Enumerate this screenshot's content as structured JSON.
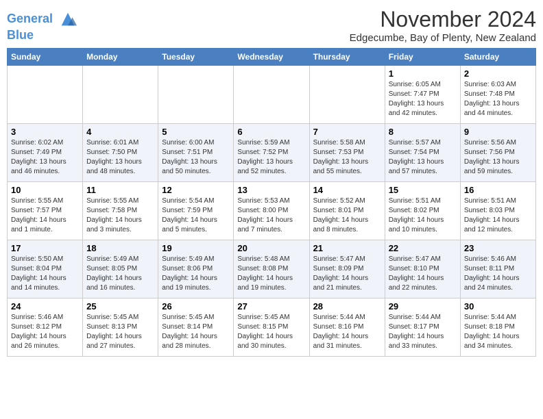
{
  "header": {
    "logo_line1": "General",
    "logo_line2": "Blue",
    "month": "November 2024",
    "location": "Edgecumbe, Bay of Plenty, New Zealand"
  },
  "days_of_week": [
    "Sunday",
    "Monday",
    "Tuesday",
    "Wednesday",
    "Thursday",
    "Friday",
    "Saturday"
  ],
  "weeks": [
    [
      {
        "day": "",
        "info": ""
      },
      {
        "day": "",
        "info": ""
      },
      {
        "day": "",
        "info": ""
      },
      {
        "day": "",
        "info": ""
      },
      {
        "day": "",
        "info": ""
      },
      {
        "day": "1",
        "info": "Sunrise: 6:05 AM\nSunset: 7:47 PM\nDaylight: 13 hours\nand 42 minutes."
      },
      {
        "day": "2",
        "info": "Sunrise: 6:03 AM\nSunset: 7:48 PM\nDaylight: 13 hours\nand 44 minutes."
      }
    ],
    [
      {
        "day": "3",
        "info": "Sunrise: 6:02 AM\nSunset: 7:49 PM\nDaylight: 13 hours\nand 46 minutes."
      },
      {
        "day": "4",
        "info": "Sunrise: 6:01 AM\nSunset: 7:50 PM\nDaylight: 13 hours\nand 48 minutes."
      },
      {
        "day": "5",
        "info": "Sunrise: 6:00 AM\nSunset: 7:51 PM\nDaylight: 13 hours\nand 50 minutes."
      },
      {
        "day": "6",
        "info": "Sunrise: 5:59 AM\nSunset: 7:52 PM\nDaylight: 13 hours\nand 52 minutes."
      },
      {
        "day": "7",
        "info": "Sunrise: 5:58 AM\nSunset: 7:53 PM\nDaylight: 13 hours\nand 55 minutes."
      },
      {
        "day": "8",
        "info": "Sunrise: 5:57 AM\nSunset: 7:54 PM\nDaylight: 13 hours\nand 57 minutes."
      },
      {
        "day": "9",
        "info": "Sunrise: 5:56 AM\nSunset: 7:56 PM\nDaylight: 13 hours\nand 59 minutes."
      }
    ],
    [
      {
        "day": "10",
        "info": "Sunrise: 5:55 AM\nSunset: 7:57 PM\nDaylight: 14 hours\nand 1 minute."
      },
      {
        "day": "11",
        "info": "Sunrise: 5:55 AM\nSunset: 7:58 PM\nDaylight: 14 hours\nand 3 minutes."
      },
      {
        "day": "12",
        "info": "Sunrise: 5:54 AM\nSunset: 7:59 PM\nDaylight: 14 hours\nand 5 minutes."
      },
      {
        "day": "13",
        "info": "Sunrise: 5:53 AM\nSunset: 8:00 PM\nDaylight: 14 hours\nand 7 minutes."
      },
      {
        "day": "14",
        "info": "Sunrise: 5:52 AM\nSunset: 8:01 PM\nDaylight: 14 hours\nand 8 minutes."
      },
      {
        "day": "15",
        "info": "Sunrise: 5:51 AM\nSunset: 8:02 PM\nDaylight: 14 hours\nand 10 minutes."
      },
      {
        "day": "16",
        "info": "Sunrise: 5:51 AM\nSunset: 8:03 PM\nDaylight: 14 hours\nand 12 minutes."
      }
    ],
    [
      {
        "day": "17",
        "info": "Sunrise: 5:50 AM\nSunset: 8:04 PM\nDaylight: 14 hours\nand 14 minutes."
      },
      {
        "day": "18",
        "info": "Sunrise: 5:49 AM\nSunset: 8:05 PM\nDaylight: 14 hours\nand 16 minutes."
      },
      {
        "day": "19",
        "info": "Sunrise: 5:49 AM\nSunset: 8:06 PM\nDaylight: 14 hours\nand 19 minutes."
      },
      {
        "day": "20",
        "info": "Sunrise: 5:48 AM\nSunset: 8:08 PM\nDaylight: 14 hours\nand 19 minutes."
      },
      {
        "day": "21",
        "info": "Sunrise: 5:47 AM\nSunset: 8:09 PM\nDaylight: 14 hours\nand 21 minutes."
      },
      {
        "day": "22",
        "info": "Sunrise: 5:47 AM\nSunset: 8:10 PM\nDaylight: 14 hours\nand 22 minutes."
      },
      {
        "day": "23",
        "info": "Sunrise: 5:46 AM\nSunset: 8:11 PM\nDaylight: 14 hours\nand 24 minutes."
      }
    ],
    [
      {
        "day": "24",
        "info": "Sunrise: 5:46 AM\nSunset: 8:12 PM\nDaylight: 14 hours\nand 26 minutes."
      },
      {
        "day": "25",
        "info": "Sunrise: 5:45 AM\nSunset: 8:13 PM\nDaylight: 14 hours\nand 27 minutes."
      },
      {
        "day": "26",
        "info": "Sunrise: 5:45 AM\nSunset: 8:14 PM\nDaylight: 14 hours\nand 28 minutes."
      },
      {
        "day": "27",
        "info": "Sunrise: 5:45 AM\nSunset: 8:15 PM\nDaylight: 14 hours\nand 30 minutes."
      },
      {
        "day": "28",
        "info": "Sunrise: 5:44 AM\nSunset: 8:16 PM\nDaylight: 14 hours\nand 31 minutes."
      },
      {
        "day": "29",
        "info": "Sunrise: 5:44 AM\nSunset: 8:17 PM\nDaylight: 14 hours\nand 33 minutes."
      },
      {
        "day": "30",
        "info": "Sunrise: 5:44 AM\nSunset: 8:18 PM\nDaylight: 14 hours\nand 34 minutes."
      }
    ]
  ]
}
